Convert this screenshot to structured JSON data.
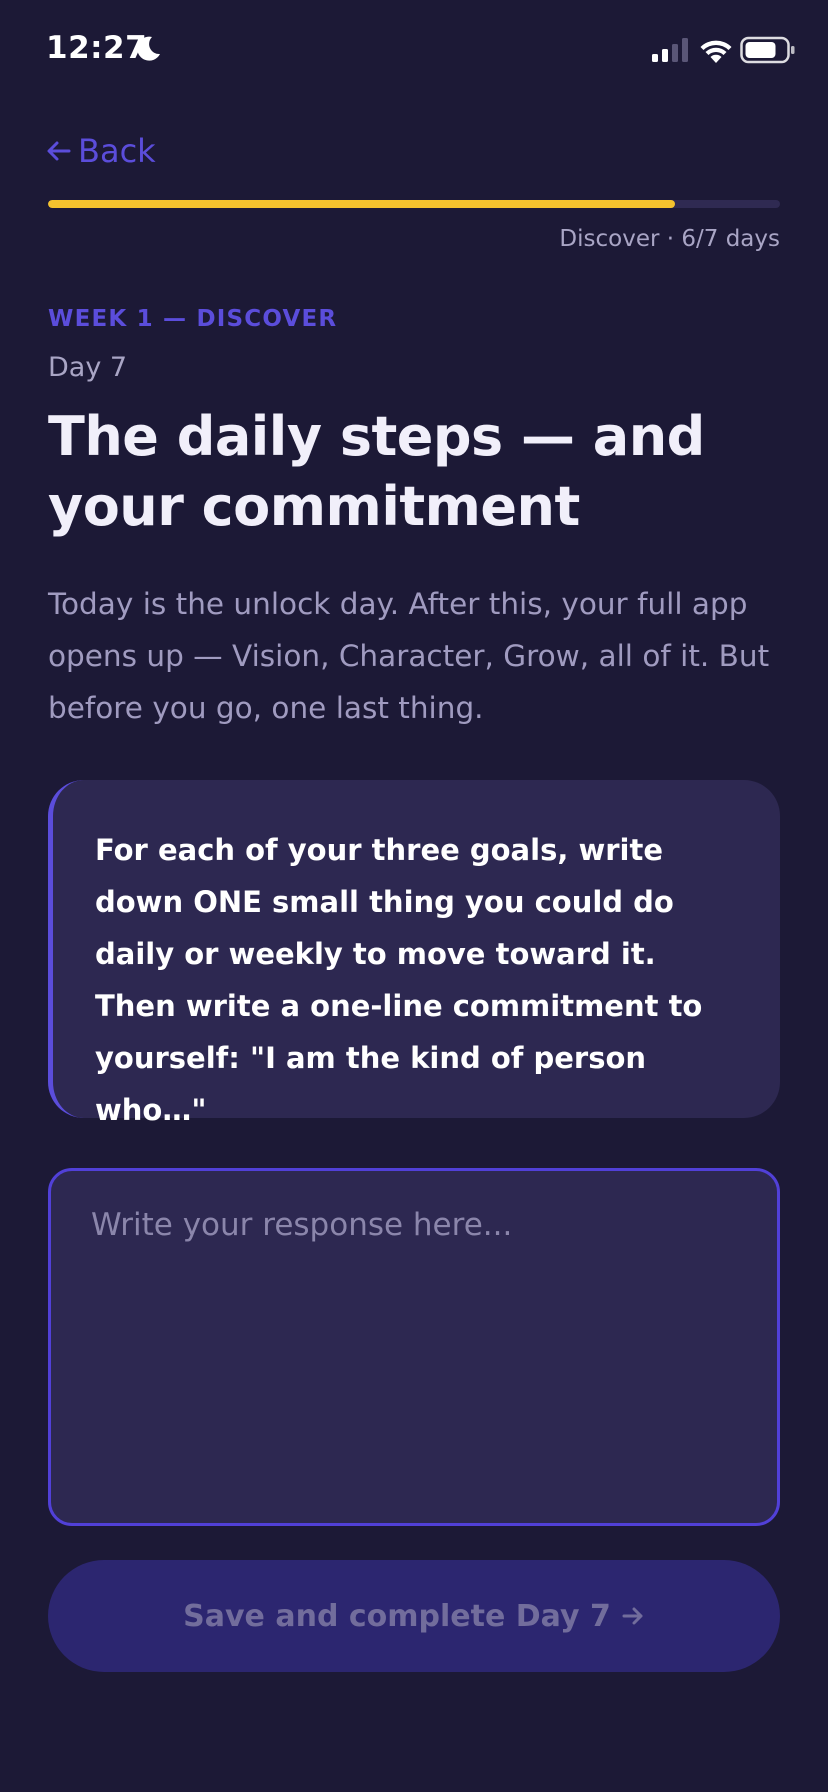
{
  "status_bar": {
    "time": "12:27"
  },
  "nav": {
    "back_label": "Back"
  },
  "progress": {
    "value": 0.857,
    "caption": "Discover · 6/7 days"
  },
  "lesson": {
    "eyebrow": "WEEK 1 — DISCOVER",
    "day": "Day 7",
    "title": "The daily steps — and your commitment",
    "intro": "Today is the unlock day. After this, your full app opens up — Vision, Character, Grow, all of it. But before you go, one last thing.",
    "prompt": "For each of your three goals, write down ONE small thing you could do daily or weekly to move toward it. Then write a one-line commitment to yourself: \"I am the kind of person who…\""
  },
  "response": {
    "placeholder": "Write your response here...",
    "value": ""
  },
  "actions": {
    "save_label": "Save and complete Day 7"
  },
  "colors": {
    "background": "#1c1936",
    "accent": "#5b4ddb",
    "progress": "#f4c22e",
    "card": "#2d2851"
  },
  "icons": {
    "back": "arrow-left-icon",
    "status_mode": "moon-icon",
    "save": "arrow-right-icon"
  }
}
